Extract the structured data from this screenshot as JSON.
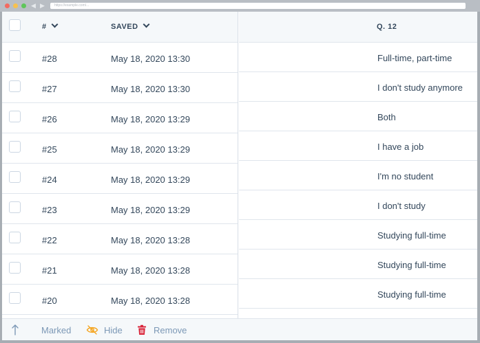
{
  "browser": {
    "url": "https://example.com/..."
  },
  "table": {
    "columns": {
      "num": "#",
      "saved": "SAVED",
      "q": "Q. 12"
    },
    "rows": [
      {
        "num": "#28",
        "saved": "May 18, 2020 13:30",
        "answer": "Full-time, part-time"
      },
      {
        "num": "#27",
        "saved": "May 18, 2020 13:30",
        "answer": "I don't study anymore"
      },
      {
        "num": "#26",
        "saved": "May 18, 2020 13:29",
        "answer": "Both"
      },
      {
        "num": "#25",
        "saved": "May 18, 2020 13:29",
        "answer": "I have a job"
      },
      {
        "num": "#24",
        "saved": "May 18, 2020 13:29",
        "answer": "I'm no student"
      },
      {
        "num": "#23",
        "saved": "May 18, 2020 13:29",
        "answer": "I don't study"
      },
      {
        "num": "#22",
        "saved": "May 18, 2020 13:28",
        "answer": "Studying full-time"
      },
      {
        "num": "#21",
        "saved": "May 18, 2020 13:28",
        "answer": "Studying full-time"
      },
      {
        "num": "#20",
        "saved": "May 18, 2020 13:28",
        "answer": "Studying full-time"
      }
    ]
  },
  "footer": {
    "marked": "Marked",
    "hide": "Hide",
    "remove": "Remove"
  },
  "colors": {
    "accent_orange": "#f5a623",
    "remove_red": "#d9253a",
    "text_muted": "#7c98b6"
  },
  "icons": {
    "marked": "arrow-up-icon",
    "hide": "eye-off-icon",
    "remove": "trash-icon"
  }
}
